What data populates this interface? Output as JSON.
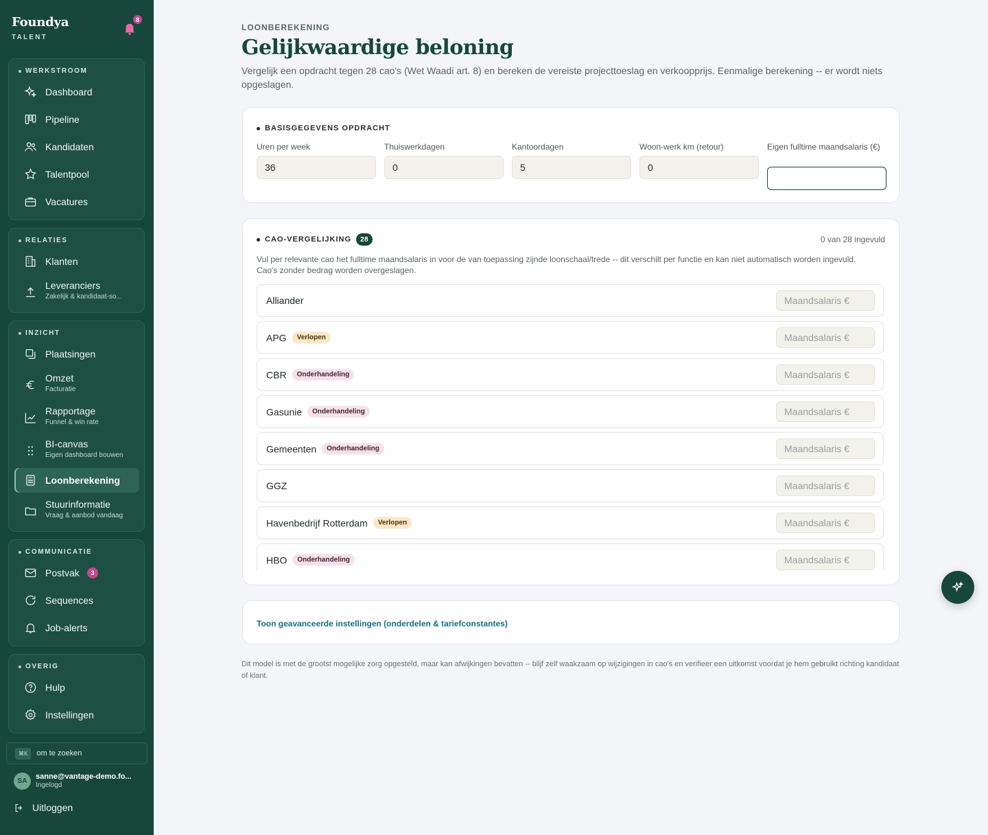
{
  "sidebar": {
    "brand": {
      "name": "Foundya",
      "sub": "TALENT"
    },
    "notifications_count": "8",
    "sections": {
      "werkstroom": {
        "title": "WERKSTROOM",
        "items": [
          {
            "label": "Dashboard",
            "icon": "sparkles-icon"
          },
          {
            "label": "Pipeline",
            "icon": "kanban-icon"
          },
          {
            "label": "Kandidaten",
            "icon": "users-icon"
          },
          {
            "label": "Talentpool",
            "icon": "star-icon"
          },
          {
            "label": "Vacatures",
            "icon": "briefcase-icon"
          }
        ]
      },
      "relaties": {
        "title": "RELATIES",
        "items": [
          {
            "label": "Klanten",
            "icon": "building-icon"
          },
          {
            "label": "Leveranciers",
            "sub": "Zakelijk & kandidaat-so...",
            "icon": "upload-icon"
          }
        ]
      },
      "inzicht": {
        "title": "INZICHT",
        "items": [
          {
            "label": "Plaatsingen",
            "icon": "copy-icon"
          },
          {
            "label": "Omzet",
            "sub": "Facturatie",
            "icon": "euro-icon"
          },
          {
            "label": "Rapportage",
            "sub": "Funnel & win rate",
            "icon": "chart-line-icon"
          },
          {
            "label": "BI-canvas",
            "sub": "Eigen dashboard bouwen",
            "icon": "grid-dots-icon"
          },
          {
            "label": "Loonberekening",
            "icon": "calculator-icon",
            "active": true
          },
          {
            "label": "Stuurinformatie",
            "sub": "Vraag & aanbod vandaag",
            "icon": "folder-icon"
          }
        ]
      },
      "communicatie": {
        "title": "COMMUNICATIE",
        "items": [
          {
            "label": "Postvak",
            "badge": "3",
            "icon": "mail-icon"
          },
          {
            "label": "Sequences",
            "icon": "refresh-icon"
          },
          {
            "label": "Job-alerts",
            "icon": "bell-icon"
          }
        ]
      },
      "overig": {
        "title": "OVERIG",
        "items": [
          {
            "label": "Hulp",
            "icon": "help-circle-icon"
          },
          {
            "label": "Instellingen",
            "icon": "gear-icon"
          }
        ]
      }
    },
    "search": {
      "kbd": "⌘K",
      "label": "om te zoeken"
    },
    "user": {
      "initials": "SA",
      "email": "sanne@vantage-demo.fo...",
      "status": "Ingelogd"
    },
    "logout": "Uitloggen"
  },
  "page": {
    "eyebrow": "LOONBEREKENING",
    "title": "Gelijkwaardige beloning",
    "description": "Vergelijk een opdracht tegen 28 cao's (Wet Waadi art. 8) en bereken de vereiste projecttoeslag en verkoopprijs. Eenmalige berekening -- er wordt niets opgeslagen."
  },
  "basis": {
    "title": "BASISGEGEVENS OPDRACHT",
    "fields": [
      {
        "label": "Uren per week",
        "value": "36"
      },
      {
        "label": "Thuiswerkdagen",
        "value": "0"
      },
      {
        "label": "Kantoordagen",
        "value": "5"
      },
      {
        "label": "Woon-werk km (retour)",
        "value": "0"
      },
      {
        "label": "Eigen fulltime maandsalaris (€)",
        "value": ""
      }
    ]
  },
  "cao": {
    "title": "CAO-VERGELIJKING",
    "count": "28",
    "filled": "0 van 28 ingevuld",
    "description": "Vul per relevante cao het fulltime maandsalaris in voor de van toepassing zijnde loonschaal/trede -- dit verschilt per functie en kan niet automatisch worden ingevuld. Cao's zonder bedrag worden overgeslagen.",
    "placeholder": "Maandsalaris €",
    "rows": [
      {
        "name": "Alliander",
        "tag": "",
        "tag_type": ""
      },
      {
        "name": "APG",
        "tag": "Verlopen",
        "tag_type": "verlopen"
      },
      {
        "name": "CBR",
        "tag": "Onderhandeling",
        "tag_type": "onder"
      },
      {
        "name": "Gasunie",
        "tag": "Onderhandeling",
        "tag_type": "onder"
      },
      {
        "name": "Gemeenten",
        "tag": "Onderhandeling",
        "tag_type": "onder"
      },
      {
        "name": "GGZ",
        "tag": "",
        "tag_type": ""
      },
      {
        "name": "Havenbedrijf Rotterdam",
        "tag": "Verlopen",
        "tag_type": "verlopen"
      },
      {
        "name": "HBO",
        "tag": "Onderhandeling",
        "tag_type": "onder"
      }
    ]
  },
  "advanced": {
    "link": "Toon geavanceerde instellingen (onderdelen & tariefconstantes)"
  },
  "footnote": "Dit model is met de grootst mogelijke zorg opgesteld, maar kan afwijkingen bevatten -- blijf zelf waakzaam op wijzigingen in cao's en verifieer een uitkomst voordat je hem gebruikt richting kandidaat of klant.",
  "colors": {
    "sidebar": "#17473a",
    "accent": "#17473a",
    "link": "#136e8a",
    "badge": "#c7468a"
  },
  "fab_icon": "sparkles-icon"
}
